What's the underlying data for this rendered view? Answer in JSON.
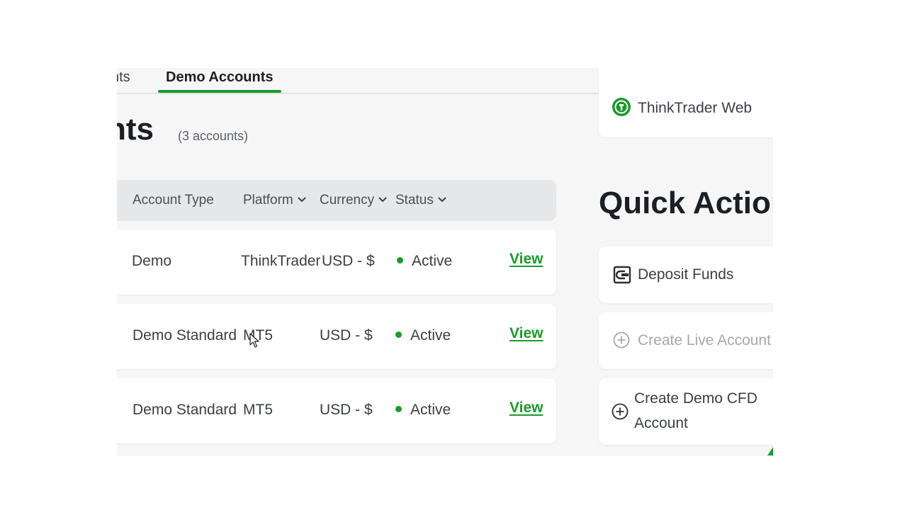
{
  "tabs": [
    {
      "label": "nts",
      "active": false
    },
    {
      "label": "Demo Accounts",
      "active": true
    }
  ],
  "page": {
    "title": "nts",
    "account_count": "(3 accounts)"
  },
  "table": {
    "headers": [
      {
        "label": "Account Type",
        "has_dropdown": false
      },
      {
        "label": "Platform",
        "has_dropdown": true
      },
      {
        "label": "Currency",
        "has_dropdown": true
      },
      {
        "label": "Status",
        "has_dropdown": true
      }
    ],
    "rows": [
      {
        "fragment": "/",
        "account_type": "Demo",
        "platform": "ThinkTrader",
        "currency": "USD - $",
        "status": "Active",
        "action": "View"
      },
      {
        "fragment": "",
        "account_type": "Demo Standard",
        "platform": "MT5",
        "currency": "USD - $",
        "status": "Active",
        "action": "View"
      },
      {
        "fragment": "",
        "account_type": "Demo Standard",
        "platform": "MT5",
        "currency": "USD - $",
        "status": "Active",
        "action": "View"
      }
    ]
  },
  "platform_card": {
    "label": "ThinkTrader Web",
    "icon": "thinktrader-logo-icon"
  },
  "quick_actions": {
    "title": "Quick Actions",
    "items": [
      {
        "label": "Deposit Funds",
        "icon": "wallet-icon",
        "disabled": false
      },
      {
        "label": "Create Live Account",
        "icon": "plus-circle-icon",
        "disabled": true
      },
      {
        "label_line1": "Create Demo CFD",
        "label_line2": "Account",
        "icon": "plus-circle-icon",
        "disabled": false
      }
    ]
  },
  "colors": {
    "accent": "#1a9a2c",
    "text": "#3a3f45",
    "header_bg": "#e5e7e8",
    "page_bg": "#f6f6f6",
    "muted": "#a4a8ad"
  }
}
